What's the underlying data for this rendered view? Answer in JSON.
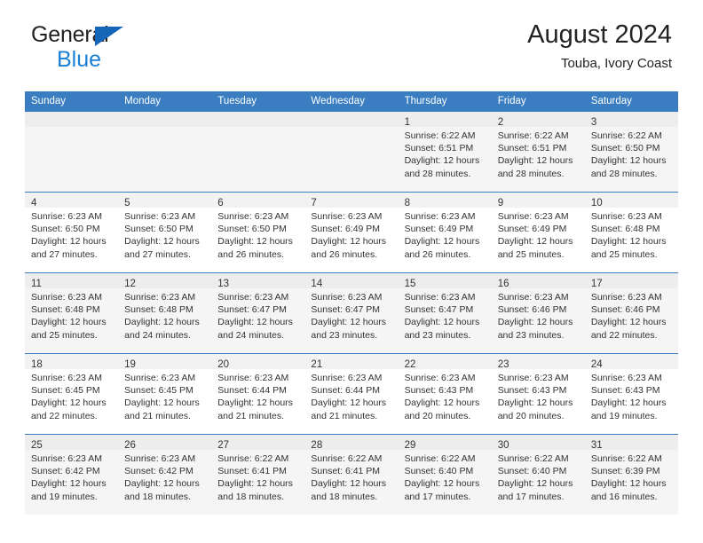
{
  "brand": {
    "name_top": "General",
    "name_bottom": "Blue",
    "triangle_color": "#1565b8",
    "blue_color": "#1a7fd4"
  },
  "header": {
    "title": "August 2024",
    "subtitle": "Touba, Ivory Coast"
  },
  "theme": {
    "header_row_bg": "#3a7ec1",
    "header_row_text": "#ffffff",
    "shaded_row_bg": "#f5f5f5",
    "daynum_bar_bg": "#f2f2f2",
    "grid_line": "#3a7ec1"
  },
  "weekdays": [
    "Sunday",
    "Monday",
    "Tuesday",
    "Wednesday",
    "Thursday",
    "Friday",
    "Saturday"
  ],
  "weeks": [
    [
      {
        "day": "",
        "lines": []
      },
      {
        "day": "",
        "lines": []
      },
      {
        "day": "",
        "lines": []
      },
      {
        "day": "",
        "lines": []
      },
      {
        "day": "1",
        "lines": [
          "Sunrise: 6:22 AM",
          "Sunset: 6:51 PM",
          "Daylight: 12 hours",
          "and 28 minutes."
        ]
      },
      {
        "day": "2",
        "lines": [
          "Sunrise: 6:22 AM",
          "Sunset: 6:51 PM",
          "Daylight: 12 hours",
          "and 28 minutes."
        ]
      },
      {
        "day": "3",
        "lines": [
          "Sunrise: 6:22 AM",
          "Sunset: 6:50 PM",
          "Daylight: 12 hours",
          "and 28 minutes."
        ]
      }
    ],
    [
      {
        "day": "4",
        "lines": [
          "Sunrise: 6:23 AM",
          "Sunset: 6:50 PM",
          "Daylight: 12 hours",
          "and 27 minutes."
        ]
      },
      {
        "day": "5",
        "lines": [
          "Sunrise: 6:23 AM",
          "Sunset: 6:50 PM",
          "Daylight: 12 hours",
          "and 27 minutes."
        ]
      },
      {
        "day": "6",
        "lines": [
          "Sunrise: 6:23 AM",
          "Sunset: 6:50 PM",
          "Daylight: 12 hours",
          "and 26 minutes."
        ]
      },
      {
        "day": "7",
        "lines": [
          "Sunrise: 6:23 AM",
          "Sunset: 6:49 PM",
          "Daylight: 12 hours",
          "and 26 minutes."
        ]
      },
      {
        "day": "8",
        "lines": [
          "Sunrise: 6:23 AM",
          "Sunset: 6:49 PM",
          "Daylight: 12 hours",
          "and 26 minutes."
        ]
      },
      {
        "day": "9",
        "lines": [
          "Sunrise: 6:23 AM",
          "Sunset: 6:49 PM",
          "Daylight: 12 hours",
          "and 25 minutes."
        ]
      },
      {
        "day": "10",
        "lines": [
          "Sunrise: 6:23 AM",
          "Sunset: 6:48 PM",
          "Daylight: 12 hours",
          "and 25 minutes."
        ]
      }
    ],
    [
      {
        "day": "11",
        "lines": [
          "Sunrise: 6:23 AM",
          "Sunset: 6:48 PM",
          "Daylight: 12 hours",
          "and 25 minutes."
        ]
      },
      {
        "day": "12",
        "lines": [
          "Sunrise: 6:23 AM",
          "Sunset: 6:48 PM",
          "Daylight: 12 hours",
          "and 24 minutes."
        ]
      },
      {
        "day": "13",
        "lines": [
          "Sunrise: 6:23 AM",
          "Sunset: 6:47 PM",
          "Daylight: 12 hours",
          "and 24 minutes."
        ]
      },
      {
        "day": "14",
        "lines": [
          "Sunrise: 6:23 AM",
          "Sunset: 6:47 PM",
          "Daylight: 12 hours",
          "and 23 minutes."
        ]
      },
      {
        "day": "15",
        "lines": [
          "Sunrise: 6:23 AM",
          "Sunset: 6:47 PM",
          "Daylight: 12 hours",
          "and 23 minutes."
        ]
      },
      {
        "day": "16",
        "lines": [
          "Sunrise: 6:23 AM",
          "Sunset: 6:46 PM",
          "Daylight: 12 hours",
          "and 23 minutes."
        ]
      },
      {
        "day": "17",
        "lines": [
          "Sunrise: 6:23 AM",
          "Sunset: 6:46 PM",
          "Daylight: 12 hours",
          "and 22 minutes."
        ]
      }
    ],
    [
      {
        "day": "18",
        "lines": [
          "Sunrise: 6:23 AM",
          "Sunset: 6:45 PM",
          "Daylight: 12 hours",
          "and 22 minutes."
        ]
      },
      {
        "day": "19",
        "lines": [
          "Sunrise: 6:23 AM",
          "Sunset: 6:45 PM",
          "Daylight: 12 hours",
          "and 21 minutes."
        ]
      },
      {
        "day": "20",
        "lines": [
          "Sunrise: 6:23 AM",
          "Sunset: 6:44 PM",
          "Daylight: 12 hours",
          "and 21 minutes."
        ]
      },
      {
        "day": "21",
        "lines": [
          "Sunrise: 6:23 AM",
          "Sunset: 6:44 PM",
          "Daylight: 12 hours",
          "and 21 minutes."
        ]
      },
      {
        "day": "22",
        "lines": [
          "Sunrise: 6:23 AM",
          "Sunset: 6:43 PM",
          "Daylight: 12 hours",
          "and 20 minutes."
        ]
      },
      {
        "day": "23",
        "lines": [
          "Sunrise: 6:23 AM",
          "Sunset: 6:43 PM",
          "Daylight: 12 hours",
          "and 20 minutes."
        ]
      },
      {
        "day": "24",
        "lines": [
          "Sunrise: 6:23 AM",
          "Sunset: 6:43 PM",
          "Daylight: 12 hours",
          "and 19 minutes."
        ]
      }
    ],
    [
      {
        "day": "25",
        "lines": [
          "Sunrise: 6:23 AM",
          "Sunset: 6:42 PM",
          "Daylight: 12 hours",
          "and 19 minutes."
        ]
      },
      {
        "day": "26",
        "lines": [
          "Sunrise: 6:23 AM",
          "Sunset: 6:42 PM",
          "Daylight: 12 hours",
          "and 18 minutes."
        ]
      },
      {
        "day": "27",
        "lines": [
          "Sunrise: 6:22 AM",
          "Sunset: 6:41 PM",
          "Daylight: 12 hours",
          "and 18 minutes."
        ]
      },
      {
        "day": "28",
        "lines": [
          "Sunrise: 6:22 AM",
          "Sunset: 6:41 PM",
          "Daylight: 12 hours",
          "and 18 minutes."
        ]
      },
      {
        "day": "29",
        "lines": [
          "Sunrise: 6:22 AM",
          "Sunset: 6:40 PM",
          "Daylight: 12 hours",
          "and 17 minutes."
        ]
      },
      {
        "day": "30",
        "lines": [
          "Sunrise: 6:22 AM",
          "Sunset: 6:40 PM",
          "Daylight: 12 hours",
          "and 17 minutes."
        ]
      },
      {
        "day": "31",
        "lines": [
          "Sunrise: 6:22 AM",
          "Sunset: 6:39 PM",
          "Daylight: 12 hours",
          "and 16 minutes."
        ]
      }
    ]
  ]
}
